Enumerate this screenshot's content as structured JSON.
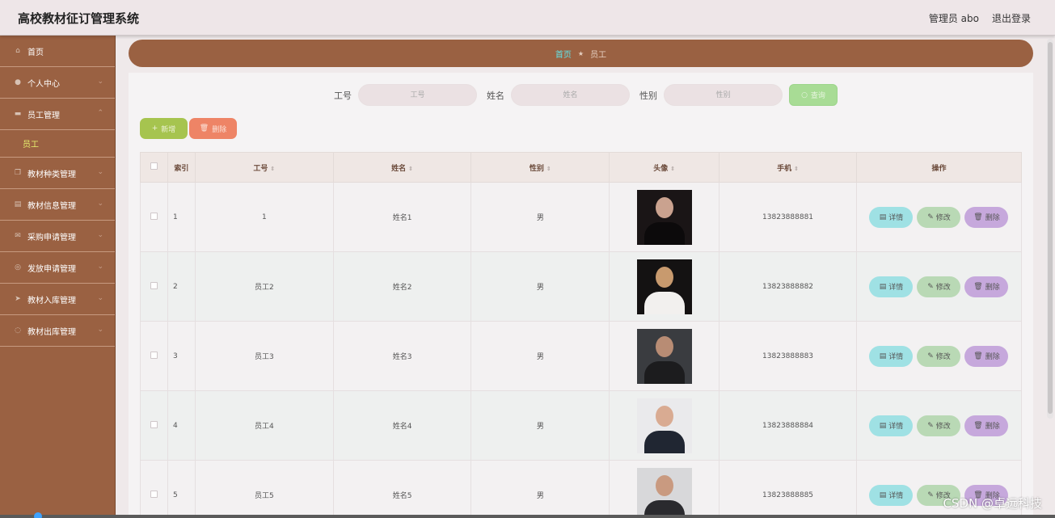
{
  "header": {
    "title": "高校教材征订管理系统",
    "user": "管理员 abo",
    "logout": "退出登录"
  },
  "sidebar": {
    "items": [
      {
        "label": "首页",
        "icon": "home-icon",
        "glyph": "⌂"
      },
      {
        "label": "个人中心",
        "icon": "user-icon",
        "glyph": "●"
      },
      {
        "label": "员工管理",
        "icon": "staff-icon",
        "glyph": "▬",
        "expanded": true,
        "children": [
          {
            "label": "员工"
          }
        ]
      },
      {
        "label": "教材种类管理",
        "icon": "copy-icon",
        "glyph": "❐"
      },
      {
        "label": "教材信息管理",
        "icon": "chart-icon",
        "glyph": "▤"
      },
      {
        "label": "采购申请管理",
        "icon": "mail-icon",
        "glyph": "✉"
      },
      {
        "label": "发放申请管理",
        "icon": "compass-icon",
        "glyph": "◎"
      },
      {
        "label": "教材入库管理",
        "icon": "send-icon",
        "glyph": "➤"
      },
      {
        "label": "教材出库管理",
        "icon": "globe-icon",
        "glyph": "◌"
      }
    ]
  },
  "breadcrumb": {
    "home": "首页",
    "current": "员工"
  },
  "search": {
    "fields": [
      {
        "label": "工号",
        "placeholder": "工号"
      },
      {
        "label": "姓名",
        "placeholder": "姓名"
      },
      {
        "label": "性别",
        "placeholder": "性别"
      }
    ],
    "button": "查询"
  },
  "actions": {
    "add": "新增",
    "delete": "删除"
  },
  "table": {
    "headers": [
      "索引",
      "工号",
      "姓名",
      "性别",
      "头像",
      "手机",
      "操作"
    ],
    "rows": [
      {
        "index": "1",
        "no": "1",
        "name": "姓名1",
        "gender": "男",
        "phone": "13823888881"
      },
      {
        "index": "2",
        "no": "员工2",
        "name": "姓名2",
        "gender": "男",
        "phone": "13823888882"
      },
      {
        "index": "3",
        "no": "员工3",
        "name": "姓名3",
        "gender": "男",
        "phone": "13823888883"
      },
      {
        "index": "4",
        "no": "员工4",
        "name": "姓名4",
        "gender": "男",
        "phone": "13823888884"
      },
      {
        "index": "5",
        "no": "员工5",
        "name": "姓名5",
        "gender": "男",
        "phone": "13823888885"
      }
    ],
    "ops": {
      "detail": "详情",
      "edit": "修改",
      "remove": "删除"
    }
  },
  "watermark": "CSDN @卓远科技",
  "colors": {
    "sidebar": "#9a6142",
    "accent_cyan": "#62e2e6",
    "submenu": "#e7f06e"
  }
}
